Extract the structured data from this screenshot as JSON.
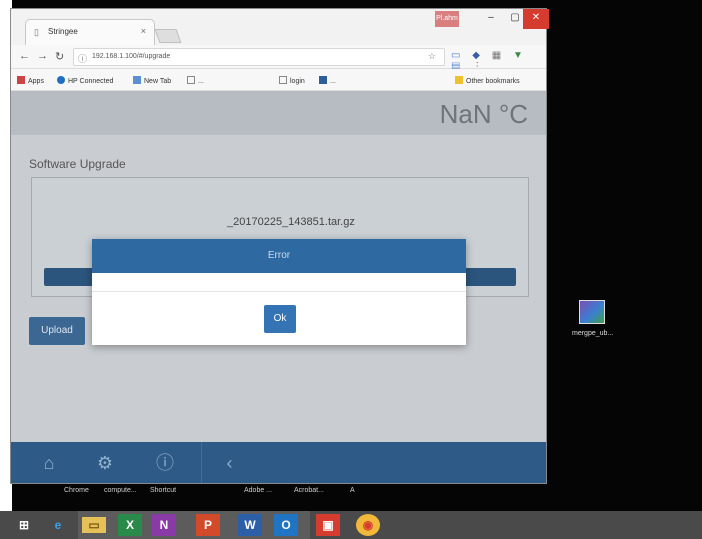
{
  "browser": {
    "tab_title": "Stringee",
    "user_badge": "Pl.ahm",
    "url": "192.168.1.100/#/upgrade",
    "bookmarks": [
      "Apps",
      "HP Connected",
      "New Tab",
      "...",
      "login",
      "..."
    ],
    "other_bookmarks": "Other bookmarks"
  },
  "app": {
    "temperature": "NaN °C",
    "section_title": "Software Upgrade",
    "filename": "_20170225_143851.tar.gz",
    "upload_label": "Upload"
  },
  "modal": {
    "title": "Error",
    "ok_label": "Ok"
  },
  "desktop": {
    "icon_label": "mergpe_ub...",
    "labels": [
      "Chrome",
      "compute...",
      "Shortcut",
      "Adobe ...",
      "Acrobat...",
      "A"
    ]
  },
  "taskbar": {
    "items": [
      "windows-start",
      "ie",
      "file-explorer",
      "excel",
      "onenote",
      "powerpoint",
      "word",
      "outlook",
      "office",
      "chrome"
    ]
  },
  "colors": {
    "header_blue": "#2e6aa1",
    "progress_blue": "#2b557d",
    "footer_blue": "#2d5a86",
    "close_red": "#d63b2f"
  }
}
